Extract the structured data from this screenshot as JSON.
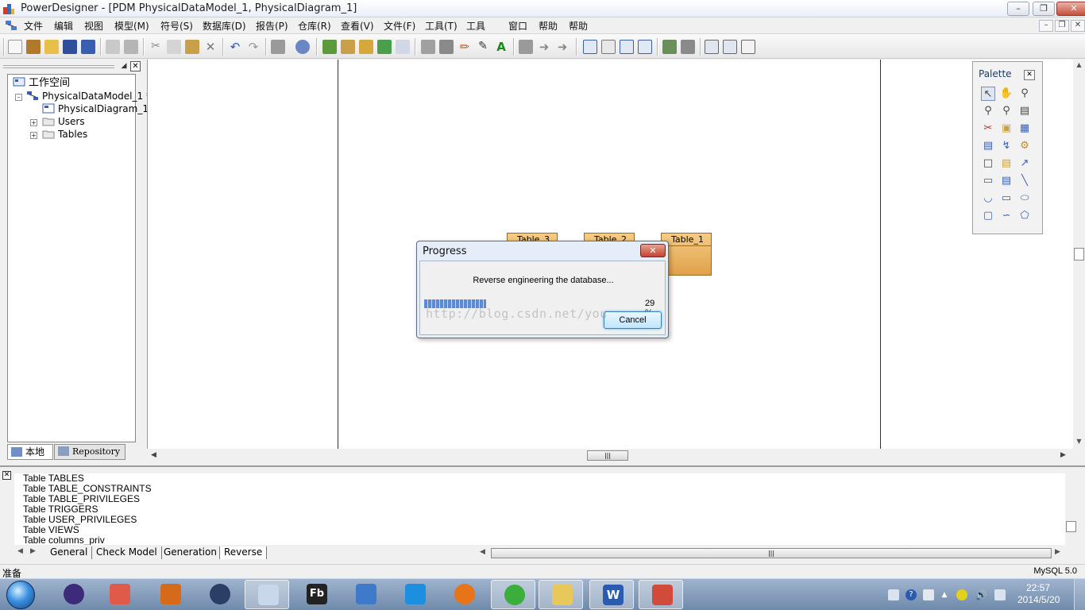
{
  "window": {
    "title": "PowerDesigner - [PDM PhysicalDataModel_1, PhysicalDiagram_1]",
    "controls": [
      "minimize",
      "maximize",
      "close"
    ]
  },
  "menu": {
    "items": [
      "文件",
      "编辑",
      "视图",
      "模型(M)",
      "符号(S)",
      "数据库(D)",
      "报告(P)",
      "仓库(R)",
      "查看(V)",
      "文件(F)",
      "工具(T)",
      "工具",
      "窗口",
      "帮助"
    ]
  },
  "browser": {
    "tree": {
      "workspace": "工作空间",
      "model": "PhysicalDataModel_1 *",
      "diagram": "PhysicalDiagram_1",
      "users": "Users",
      "tables": "Tables"
    },
    "tabs": {
      "local": "本地",
      "repository": "Repository"
    }
  },
  "diagram": {
    "tables": [
      {
        "name": "Table_3"
      },
      {
        "name": "Table_2"
      },
      {
        "name": "Table_1"
      }
    ]
  },
  "palette": {
    "title": "Palette"
  },
  "progress_dialog": {
    "title": "Progress",
    "message": "Reverse engineering the database...",
    "percent_text": "29 %",
    "progress_fraction": 0.29,
    "cancel_label": "Cancel"
  },
  "watermark": "http://blog.csdn.net/you",
  "output": {
    "lines": [
      "Table TABLES",
      "Table TABLE_CONSTRAINTS",
      "Table TABLE_PRIVILEGES",
      "Table TRIGGERS",
      "Table USER_PRIVILEGES",
      "Table VIEWS",
      "Table columns_priv"
    ],
    "tabs": [
      "General",
      "Check Model",
      "Generation",
      "Reverse"
    ]
  },
  "status": {
    "left": "准备",
    "right": "MySQL 5.0"
  },
  "taskbar": {
    "time": "22:57",
    "date": "2014/5/20",
    "apps": [
      "eclipse",
      "paint",
      "matlab",
      "sublime",
      "snipping-tool",
      "flash-builder",
      "virtualbox",
      "onedrive",
      "firefox",
      "sync-app",
      "file-explorer",
      "word",
      "powerdesigner"
    ]
  },
  "colors": {
    "table_fill": "#e9b160",
    "progress_fill": "#5a8bd6",
    "taskbar": "#7d97b8"
  }
}
